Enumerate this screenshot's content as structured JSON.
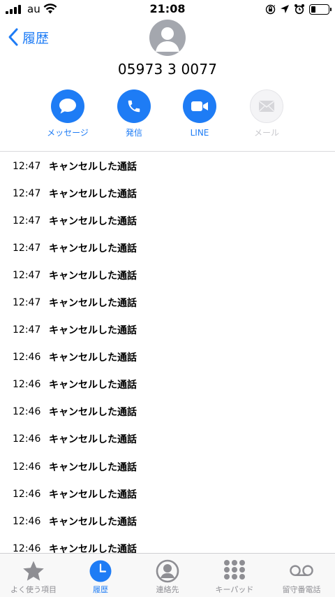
{
  "status_bar": {
    "carrier": "au",
    "time": "21:08"
  },
  "header": {
    "back_label": "履歴",
    "phone_number": "05973 3 0077"
  },
  "actions": [
    {
      "label": "メッセージ",
      "icon": "message-bubble-icon",
      "enabled": true
    },
    {
      "label": "発信",
      "icon": "phone-icon",
      "enabled": true
    },
    {
      "label": "LINE",
      "icon": "video-camera-icon",
      "enabled": true
    },
    {
      "label": "メール",
      "icon": "envelope-icon",
      "enabled": false
    }
  ],
  "calls": [
    {
      "time": "12:47",
      "status": "キャンセルした通話"
    },
    {
      "time": "12:47",
      "status": "キャンセルした通話"
    },
    {
      "time": "12:47",
      "status": "キャンセルした通話"
    },
    {
      "time": "12:47",
      "status": "キャンセルした通話"
    },
    {
      "time": "12:47",
      "status": "キャンセルした通話"
    },
    {
      "time": "12:47",
      "status": "キャンセルした通話"
    },
    {
      "time": "12:47",
      "status": "キャンセルした通話"
    },
    {
      "time": "12:46",
      "status": "キャンセルした通話"
    },
    {
      "time": "12:46",
      "status": "キャンセルした通話"
    },
    {
      "time": "12:46",
      "status": "キャンセルした通話"
    },
    {
      "time": "12:46",
      "status": "キャンセルした通話"
    },
    {
      "time": "12:46",
      "status": "キャンセルした通話"
    },
    {
      "time": "12:46",
      "status": "キャンセルした通話"
    },
    {
      "time": "12:46",
      "status": "キャンセルした通話"
    },
    {
      "time": "12:46",
      "status": "キャンセルした通話"
    }
  ],
  "tabs": [
    {
      "label": "よく使う項目",
      "icon": "star-icon",
      "active": false
    },
    {
      "label": "履歴",
      "icon": "clock-icon",
      "active": true
    },
    {
      "label": "連絡先",
      "icon": "person-circle-icon",
      "active": false
    },
    {
      "label": "キーパッド",
      "icon": "keypad-icon",
      "active": false
    },
    {
      "label": "留守番電話",
      "icon": "voicemail-icon",
      "active": false
    }
  ],
  "colors": {
    "accent": "#1e7cf5",
    "tab_inactive": "#8e8e93",
    "disabled": "#c8c8cc",
    "avatar": "#a4a7ae"
  }
}
